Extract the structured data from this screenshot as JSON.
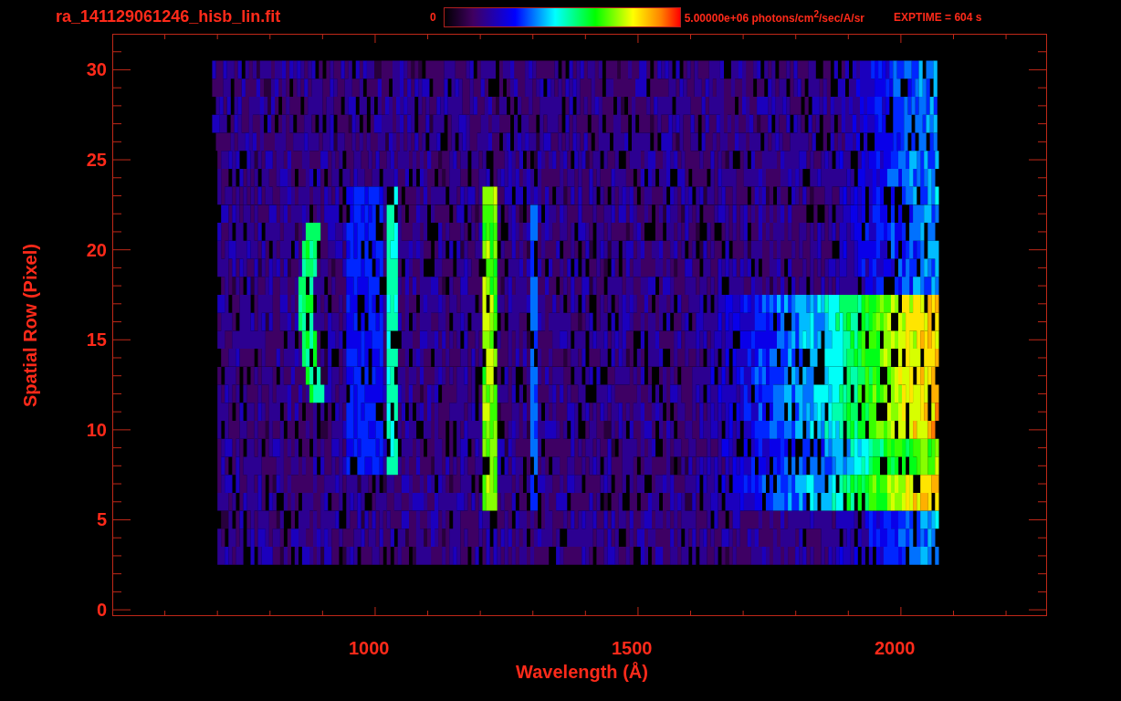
{
  "header": {
    "filename": "ra_141129061246_hisb_lin.fit",
    "colorbar": {
      "min_label": "0",
      "max_label": "5.00000e+06 photons/cm$^{2}$/sec/A/sr"
    },
    "exposure": "EXPTIME = 604 s"
  },
  "plot": {
    "ylabel": "Spatial Row (Pixel)",
    "xlabel": "Wavelength (Å)",
    "yticks": [
      "30",
      "25",
      "20",
      "15",
      "10",
      "5",
      "0"
    ],
    "xticks": [
      "1000",
      "1500",
      "2000"
    ]
  }
}
